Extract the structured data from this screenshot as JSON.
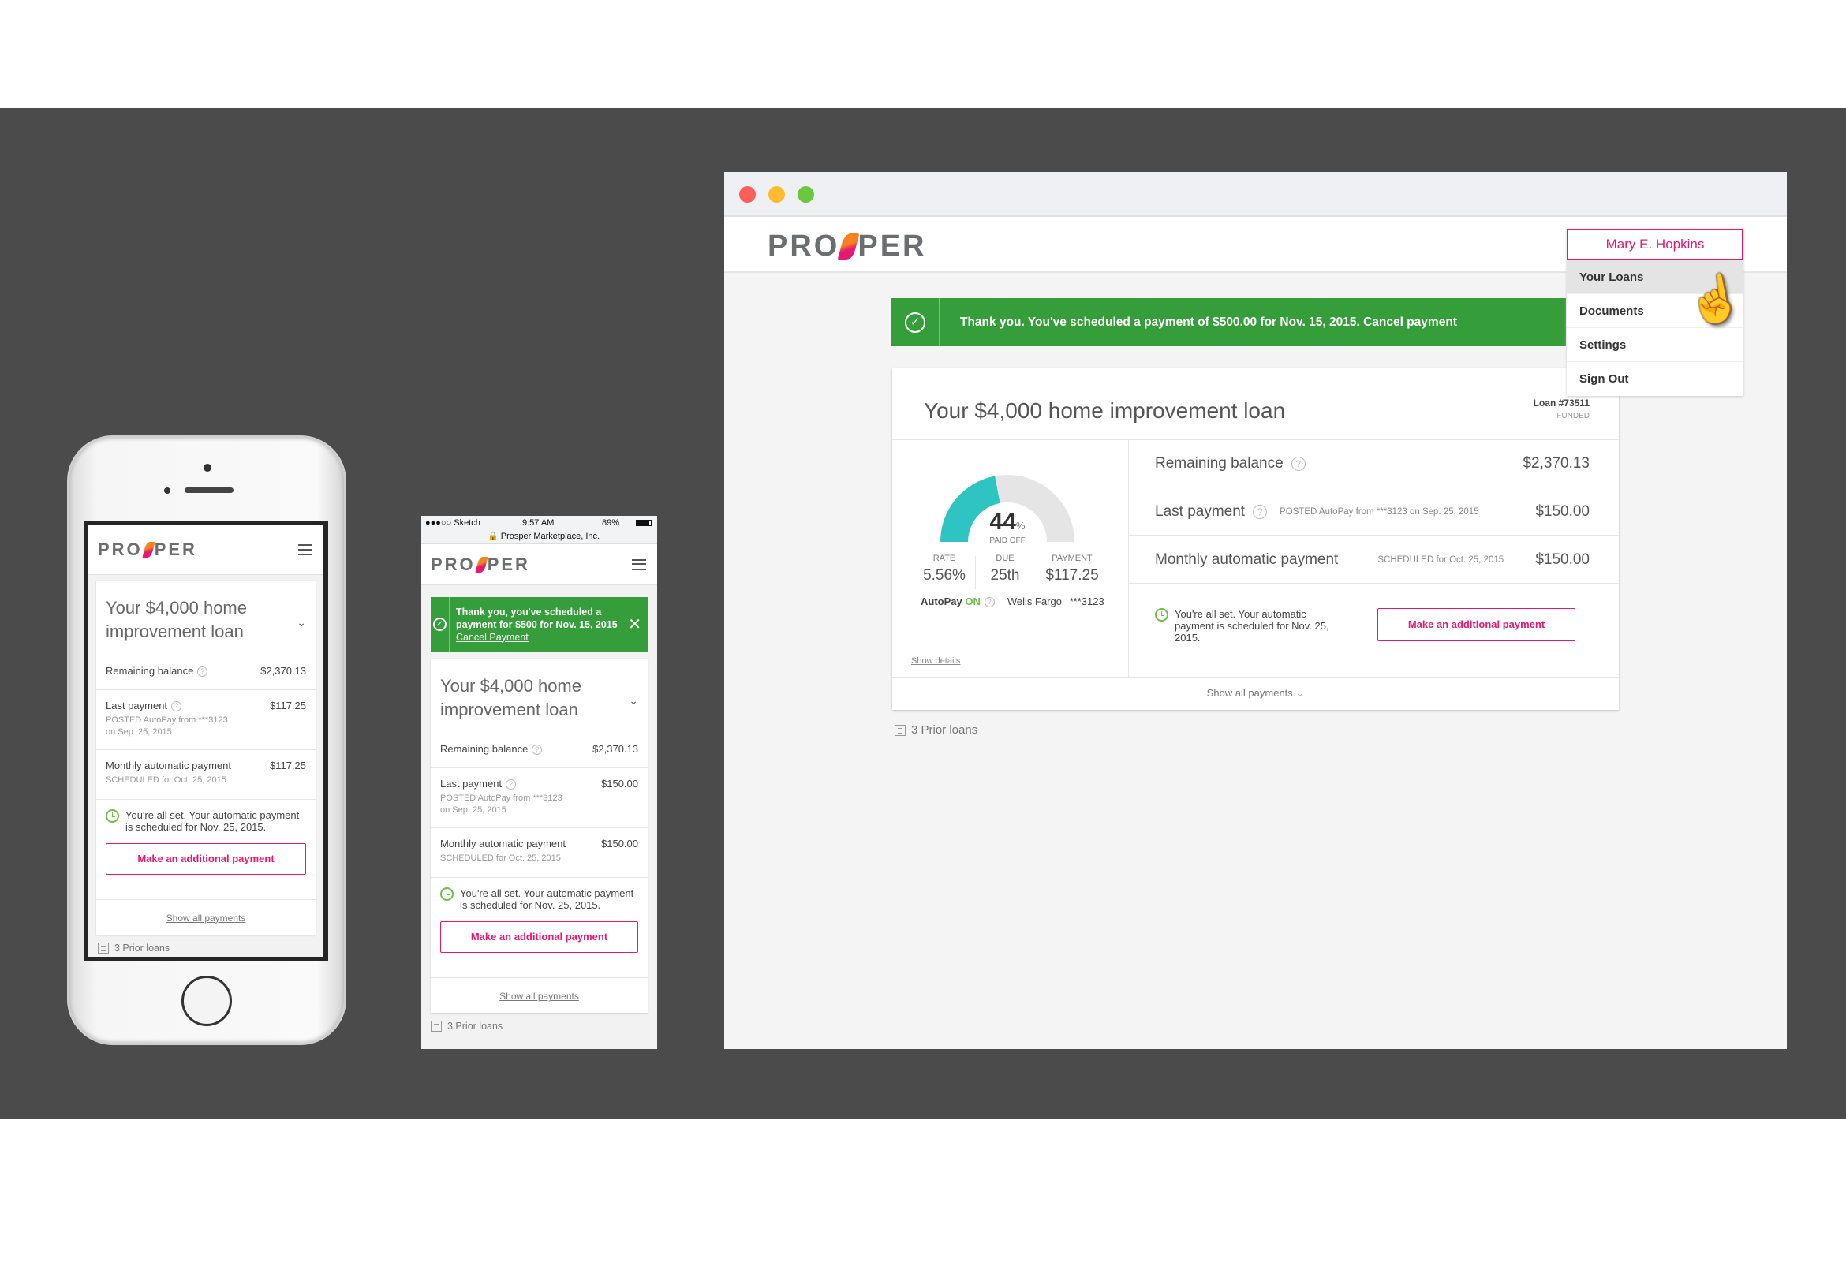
{
  "brand": {
    "logo_text_left": "PRO",
    "logo_text_right": "PER",
    "accent": "#e6186f",
    "success": "#359e3a",
    "gauge": "#2ec4c1"
  },
  "mobile1": {
    "title": "Your $4,000 home improvement loan",
    "remaining_label": "Remaining balance",
    "remaining_value": "$2,370.13",
    "last_label": "Last payment",
    "last_value": "$117.25",
    "last_meta1": "POSTED AutoPay from ***3123",
    "last_meta2": "on Sep. 25, 2015",
    "monthly_label": "Monthly automatic payment",
    "monthly_value": "$117.25",
    "monthly_meta": "SCHEDULED for Oct. 25, 2015",
    "allset": "You're all set. Your automatic payment is scheduled for Nov. 25, 2015.",
    "pay_button": "Make an additional payment",
    "show_all": "Show all payments",
    "prior": "3 Prior loans"
  },
  "mobile2": {
    "status": {
      "carrier": "●●●○○ Sketch",
      "time": "9:57 AM",
      "battery": "89%",
      "site": "Prosper Marketplace, Inc."
    },
    "banner": {
      "text": "Thank you, you've scheduled a payment for $500 for Nov. 15, 2015",
      "link": "Cancel Payment"
    },
    "title": "Your $4,000 home improvement loan",
    "remaining_label": "Remaining balance",
    "remaining_value": "$2,370.13",
    "last_label": "Last payment",
    "last_value": "$150.00",
    "last_meta1": "POSTED AutoPay from ***3123",
    "last_meta2": "on Sep. 25, 2015",
    "monthly_label": "Monthly automatic payment",
    "monthly_value": "$150.00",
    "monthly_meta": "SCHEDULED for Oct. 25, 2015",
    "allset": "You're all set. Your automatic payment is scheduled for Nov. 25, 2015.",
    "pay_button": "Make an additional payment",
    "show_all": "Show all payments",
    "prior": "3 Prior loans"
  },
  "desktop": {
    "user_menu": {
      "name": "Mary E. Hopkins",
      "items": [
        "Your Loans",
        "Documents",
        "Settings",
        "Sign Out"
      ],
      "active": "Your Loans"
    },
    "banner": {
      "text": "Thank you. You've scheduled a payment of $500.00 for Nov. 15, 2015.",
      "link": "Cancel payment"
    },
    "title": "Your $4,000 home improvement loan",
    "loan_number": "Loan #73511",
    "loan_status": "FUNDED",
    "gauge": {
      "percent": 44,
      "percent_text": "44",
      "unit": "%",
      "label": "PAID OFF"
    },
    "stats": [
      {
        "label": "RATE",
        "value": "5.56%"
      },
      {
        "label": "DUE",
        "value": "25th"
      },
      {
        "label": "PAYMENT",
        "value": "$117.25"
      }
    ],
    "autopay": {
      "label": "AutoPay",
      "state": "ON",
      "bank": "Wells Fargo",
      "account": "***3123"
    },
    "show_details": "Show details",
    "rows": [
      {
        "label": "Remaining balance",
        "meta": "",
        "value": "$2,370.13"
      },
      {
        "label": "Last payment",
        "meta": "POSTED AutoPay from ***3123 on Sep. 25, 2015",
        "value": "$150.00"
      },
      {
        "label": "Monthly automatic payment",
        "meta": "SCHEDULED for Oct. 25, 2015",
        "value": "$150.00"
      }
    ],
    "allset": "You're all set. Your automatic payment is scheduled for Nov. 25, 2015.",
    "pay_button": "Make an additional payment",
    "show_all": "Show all payments",
    "prior": "3 Prior loans"
  }
}
